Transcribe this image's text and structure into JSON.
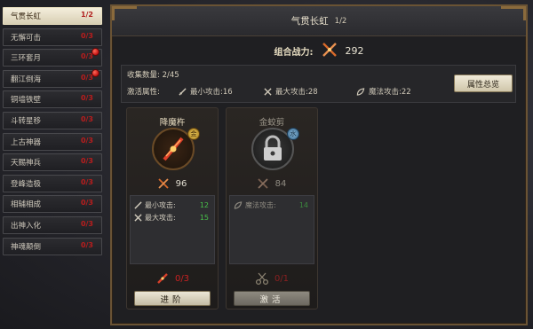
{
  "list": {
    "items": [
      {
        "label": "气贯长虹",
        "count": "1/2",
        "selected": true,
        "dot": false
      },
      {
        "label": "无懈可击",
        "count": "0/3",
        "selected": false,
        "dot": false
      },
      {
        "label": "三环套月",
        "count": "0/3",
        "selected": false,
        "dot": true
      },
      {
        "label": "翻江倒海",
        "count": "0/3",
        "selected": false,
        "dot": true
      },
      {
        "label": "铜墙铁壁",
        "count": "0/3",
        "selected": false,
        "dot": false
      },
      {
        "label": "斗转星移",
        "count": "0/3",
        "selected": false,
        "dot": false
      },
      {
        "label": "上古神器",
        "count": "0/3",
        "selected": false,
        "dot": false
      },
      {
        "label": "天赐神兵",
        "count": "0/3",
        "selected": false,
        "dot": false
      },
      {
        "label": "登峰造极",
        "count": "0/3",
        "selected": false,
        "dot": false
      },
      {
        "label": "相辅相成",
        "count": "0/3",
        "selected": false,
        "dot": false
      },
      {
        "label": "出神入化",
        "count": "0/3",
        "selected": false,
        "dot": false
      },
      {
        "label": "神魂颠倒",
        "count": "0/3",
        "selected": false,
        "dot": false
      }
    ]
  },
  "panel": {
    "title": "气贯长虹",
    "title_sub": "1/2",
    "power_label": "组合战力:",
    "power_value": "292",
    "collect_label": "收集数量: 2/45",
    "activate_label": "激活属性:",
    "attrs": [
      {
        "label": "最小攻击:16",
        "icon": "sword-icon"
      },
      {
        "label": "最大攻击:28",
        "icon": "cross-swords-icon"
      },
      {
        "label": "魔法攻击:22",
        "icon": "leaf-icon"
      }
    ],
    "summary_button": "属性总览"
  },
  "cards": [
    {
      "name": "降魔杵",
      "power": "96",
      "badge": "金",
      "attrs": [
        {
          "label": "最小攻击:",
          "value": "12"
        },
        {
          "label": "最大攻击:",
          "value": "15"
        }
      ],
      "progress": "0/3",
      "button": "进阶"
    },
    {
      "name": "金蛟剪",
      "power": "84",
      "badge": "水",
      "attrs": [
        {
          "label": "魔法攻击:",
          "value": "14"
        }
      ],
      "progress": "0/1",
      "button": "激活"
    }
  ],
  "colors": {
    "accent_gold": "#6a5334",
    "count_red": "#b81d1d",
    "attr_green": "#48c04a"
  }
}
